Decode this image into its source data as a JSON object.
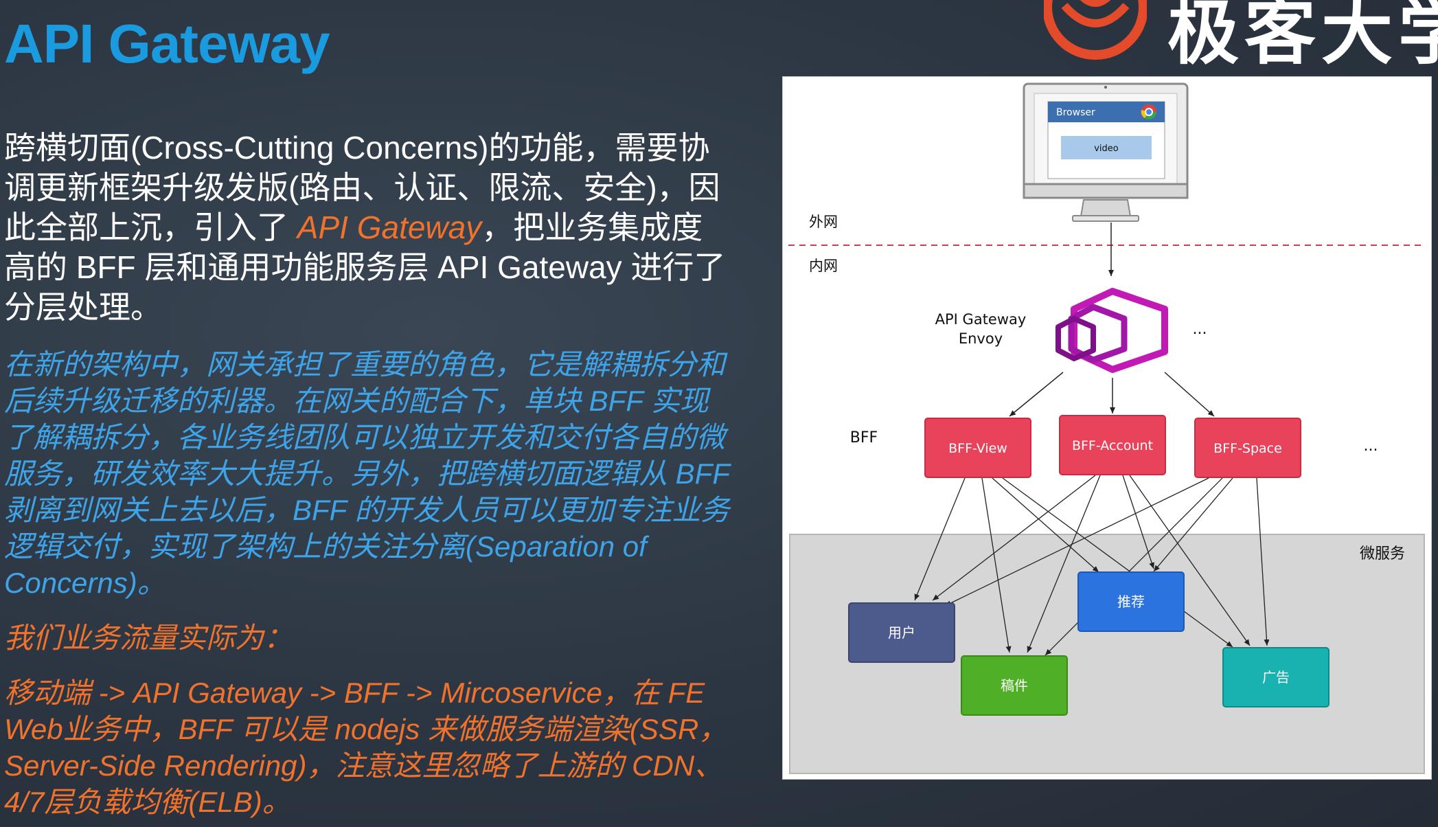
{
  "slide": {
    "title": "API Gateway",
    "logo_text": "极客大学",
    "para1_pre": "跨横切面(Cross-Cutting Concerns)的功能，需要协调更新框架升级发版(路由、认证、限流、安全)，因此全部上沉，引入了 ",
    "para1_highlight": "API Gateway",
    "para1_post": "，把业务集成度高的 BFF 层和通用功能服务层 API Gateway 进行了分层处理。",
    "para2": "在新的架构中，网关承担了重要的角色，它是解耦拆分和后续升级迁移的利器。在网关的配合下，单块 BFF 实现了解耦拆分，各业务线团队可以独立开发和交付各自的微服务，研发效率大大提升。另外，把跨横切面逻辑从 BFF 剥离到网关上去以后，BFF 的开发人员可以更加专注业务逻辑交付，实现了架构上的关注分离(Separation of Concerns)。",
    "para3": "我们业务流量实际为：",
    "para4": "移动端 -> API Gateway -> BFF -> Mircoservice，在 FE Web业务中，BFF 可以是 nodejs 来做服务端渲染(SSR，Server-Side Rendering)，注意这里忽略了上游的 CDN、4/7层负载均衡(ELB)。"
  },
  "diagram": {
    "browser_label": "Browser",
    "video_label": "video",
    "outer_net": "外网",
    "inner_net": "内网",
    "gateway_line1": "API Gateway",
    "gateway_line2": "Envoy",
    "gateway_more": "...",
    "bff_label": "BFF",
    "bff_more": "...",
    "bff_view": "BFF-View",
    "bff_account": "BFF-Account",
    "bff_space": "BFF-Space",
    "microservice_label": "微服务",
    "svc_user": "用户",
    "svc_recommend": "推荐",
    "svc_draft": "稿件",
    "svc_ad": "广告",
    "colors": {
      "bff": "#e8435a",
      "user": "#4d5a8c",
      "recommend": "#2b74e0",
      "draft": "#4fb027",
      "ad": "#18b2b0",
      "envoy": "#c21ab5",
      "dashed": "#d9394a"
    }
  }
}
